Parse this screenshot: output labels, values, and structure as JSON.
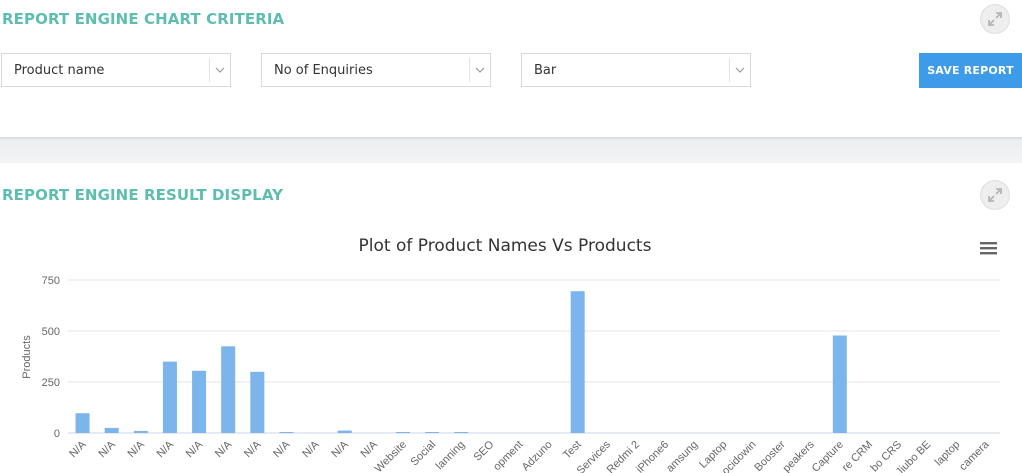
{
  "criteria_panel": {
    "title": "REPORT ENGINE CHART CRITERIA",
    "icon": "expand-icon",
    "selects": [
      {
        "value": "Product name"
      },
      {
        "value": "No of Enquiries"
      },
      {
        "value": "Bar"
      }
    ],
    "save_label": "SAVE REPORT"
  },
  "result_panel": {
    "title": "REPORT ENGINE RESULT DISPLAY",
    "icon": "expand-icon",
    "menu_icon": "hamburger-menu-icon"
  },
  "colors": {
    "accent_title": "#5dbdb0",
    "button": "#3d9be9",
    "bar": "#7cb5ec"
  },
  "chart_data": {
    "type": "bar",
    "title": "Plot of Product Names Vs Products",
    "xlabel": "",
    "ylabel": "Products",
    "ylim": [
      0,
      750
    ],
    "yticks": [
      0,
      250,
      500,
      750
    ],
    "grid": true,
    "categories": [
      "N/A",
      "N/A",
      "N/A",
      "N/A",
      "N/A",
      "N/A",
      "N/A",
      "N/A",
      "N/A",
      "N/A",
      "N/A",
      "Website",
      "Social",
      "lanning",
      "SEO",
      "opment",
      "Adzuno",
      "Test",
      "Services",
      "Redmi 2",
      "iPhone6",
      "amsung",
      "Laptop",
      "ocidowin",
      "Booster",
      "peakers",
      "Capture",
      "re CRM",
      "bo CRS",
      "Jiubo BE",
      "laptop",
      "camera"
    ],
    "series": [
      {
        "values": [
          97,
          25,
          10,
          350,
          305,
          425,
          300,
          5,
          0,
          12,
          0,
          5,
          5,
          5,
          0,
          0,
          0,
          695,
          0,
          0,
          0,
          0,
          0,
          0,
          0,
          0,
          478,
          0,
          0,
          0,
          0,
          0
        ]
      }
    ]
  }
}
